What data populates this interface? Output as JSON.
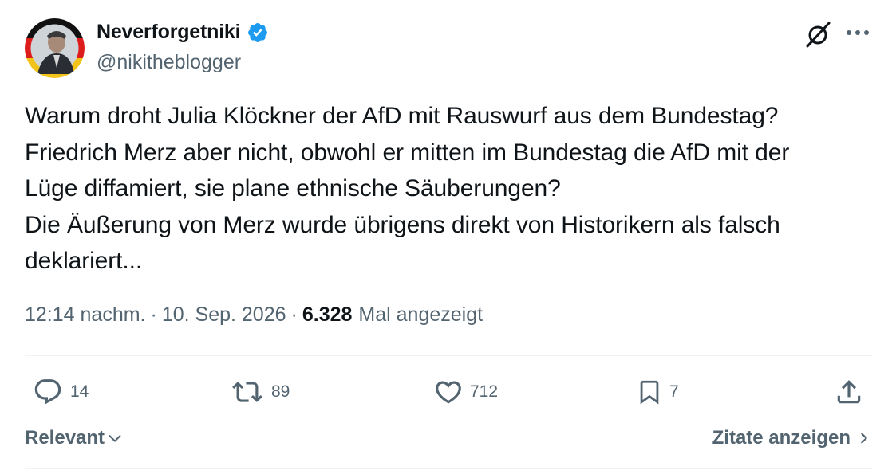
{
  "author": {
    "display_name": "Neverforgetniki",
    "handle": "@nikitheblogger",
    "verified": true,
    "verified_color": "#1d9bf0"
  },
  "header_icons": [
    "grok-icon",
    "more-icon"
  ],
  "tweet": {
    "lines": [
      "Warum droht Julia Klöckner der AfD mit Rauswurf aus dem Bundestag?",
      "Friedrich Merz aber nicht, obwohl er mitten im Bundestag die AfD mit der",
      "Lüge diffamiert, sie plane ethnische Säuberungen?",
      "Die Äußerung von Merz wurde übrigens direkt von Historikern als falsch",
      "deklariert..."
    ]
  },
  "meta": {
    "time": "12:14 nachm.",
    "separator": "·",
    "date": "10. Sep. 2026",
    "views_count": "6.328",
    "views_label": "Mal angezeigt"
  },
  "actions": {
    "replies": "14",
    "reposts": "89",
    "likes": "712",
    "bookmarks": "7"
  },
  "footer": {
    "sort_label": "Relevant",
    "quotes_label": "Zitate anzeigen"
  },
  "colors": {
    "text_primary": "#0f1419",
    "text_secondary": "#536471",
    "divider": "#eff3f4"
  }
}
